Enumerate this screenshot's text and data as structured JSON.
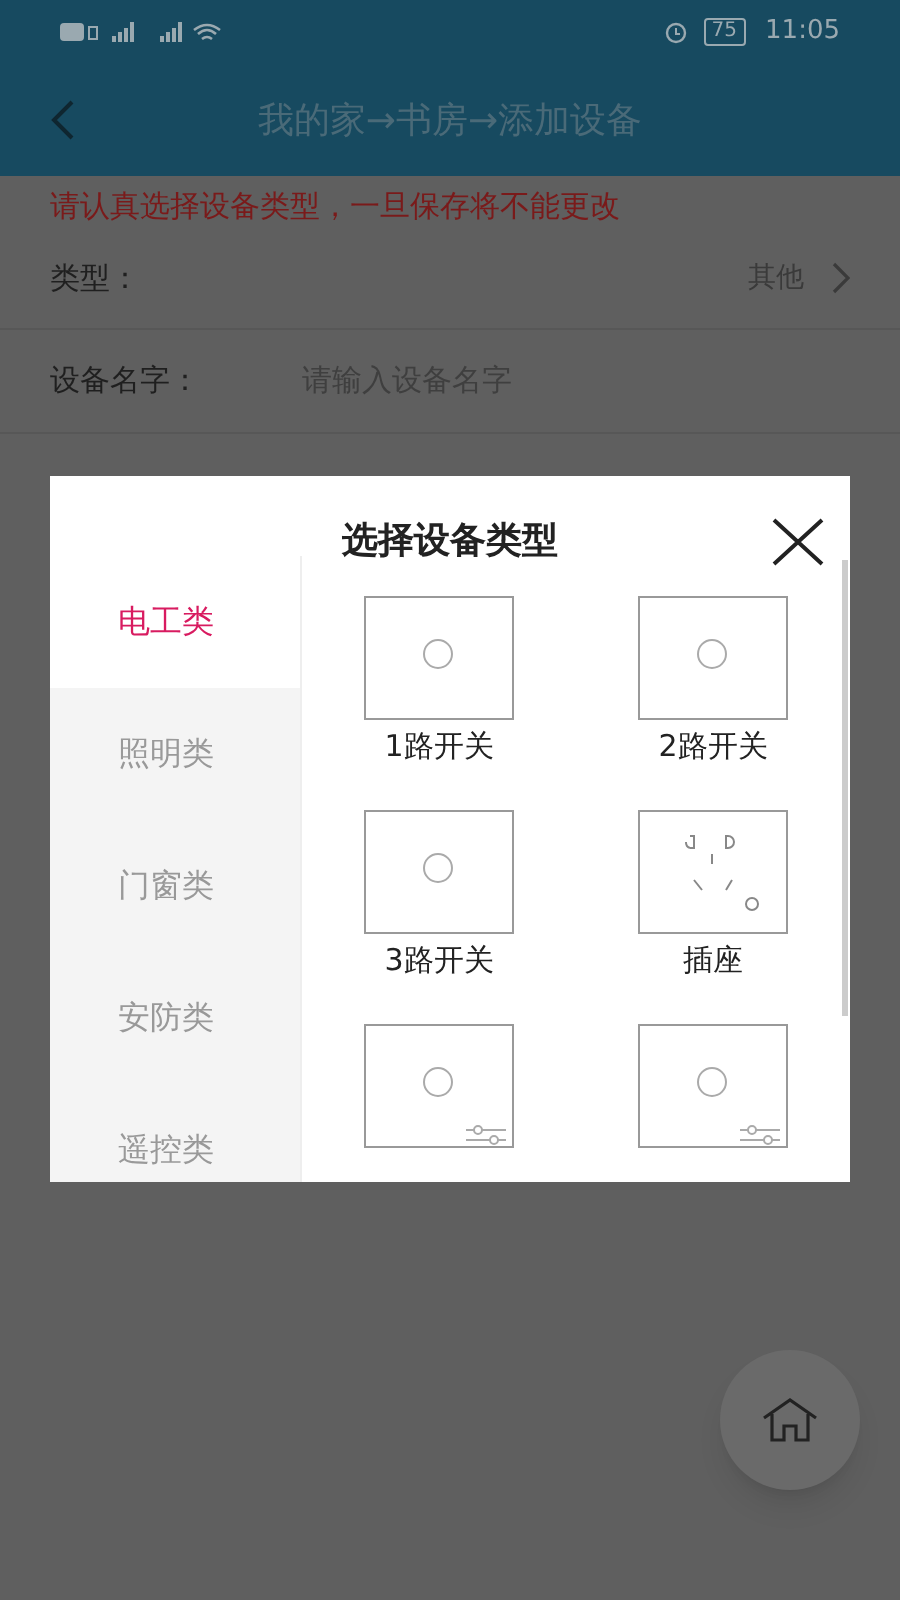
{
  "status_bar": {
    "battery": "75",
    "time": "11:05"
  },
  "header": {
    "title": "我的家→书房→添加设备"
  },
  "warning": "请认真选择设备类型，一旦保存将不能更改",
  "form": {
    "type_label": "类型：",
    "type_value": "其他",
    "name_label": "设备名字：",
    "name_placeholder": "请输入设备名字"
  },
  "dialog": {
    "title": "选择设备类型",
    "categories": [
      {
        "label": "电工类",
        "selected": true
      },
      {
        "label": "照明类",
        "selected": false
      },
      {
        "label": "门窗类",
        "selected": false
      },
      {
        "label": "安防类",
        "selected": false
      },
      {
        "label": "遥控类",
        "selected": false
      }
    ],
    "devices": [
      {
        "kind": "switch",
        "label": "1路开关"
      },
      {
        "kind": "switch",
        "label": "2路开关"
      },
      {
        "kind": "switch",
        "label": "3路开关"
      },
      {
        "kind": "socket",
        "label": "插座"
      },
      {
        "kind": "dimmer"
      },
      {
        "kind": "dimmer"
      }
    ]
  }
}
